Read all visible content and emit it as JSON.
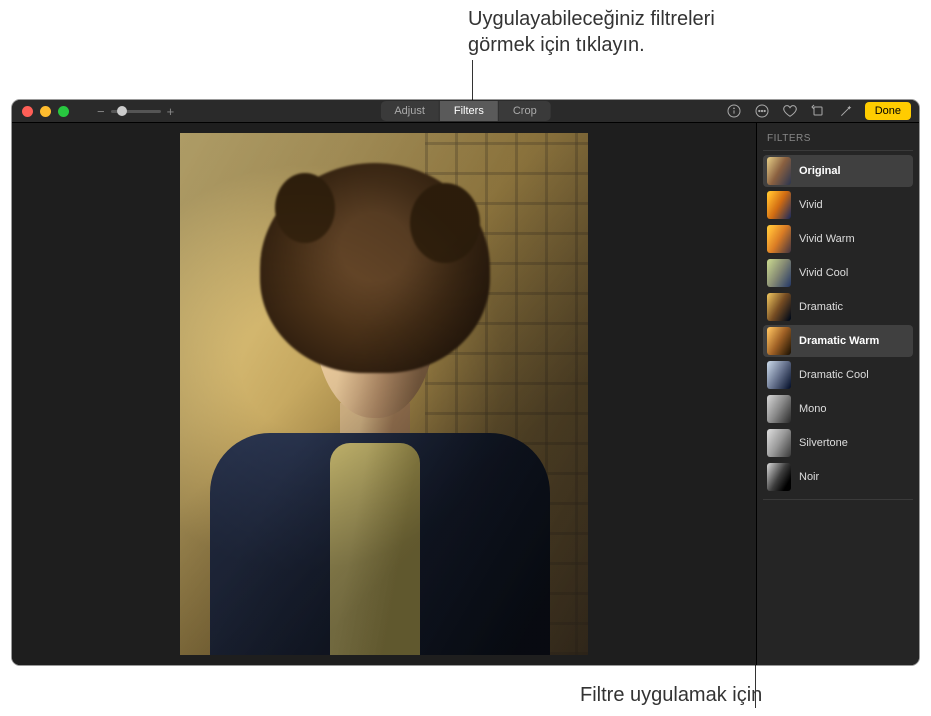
{
  "callouts": {
    "top": "Uygulayabileceğiniz filtreleri\ngörmek için tıklayın.",
    "bottom": "Filtre uygulamak için"
  },
  "toolbar": {
    "tabs": {
      "adjust": "Adjust",
      "filters": "Filters",
      "crop": "Crop"
    },
    "done": "Done"
  },
  "panel": {
    "header": "FILTERS",
    "filters": [
      {
        "label": "Original"
      },
      {
        "label": "Vivid"
      },
      {
        "label": "Vivid Warm"
      },
      {
        "label": "Vivid Cool"
      },
      {
        "label": "Dramatic"
      },
      {
        "label": "Dramatic Warm"
      },
      {
        "label": "Dramatic Cool"
      },
      {
        "label": "Mono"
      },
      {
        "label": "Silvertone"
      },
      {
        "label": "Noir"
      }
    ],
    "selected_index": 5
  },
  "icons": {
    "info": "info-icon",
    "more": "more-icon",
    "favorite": "heart-icon",
    "rotate": "rotate-icon",
    "wand": "wand-icon"
  }
}
